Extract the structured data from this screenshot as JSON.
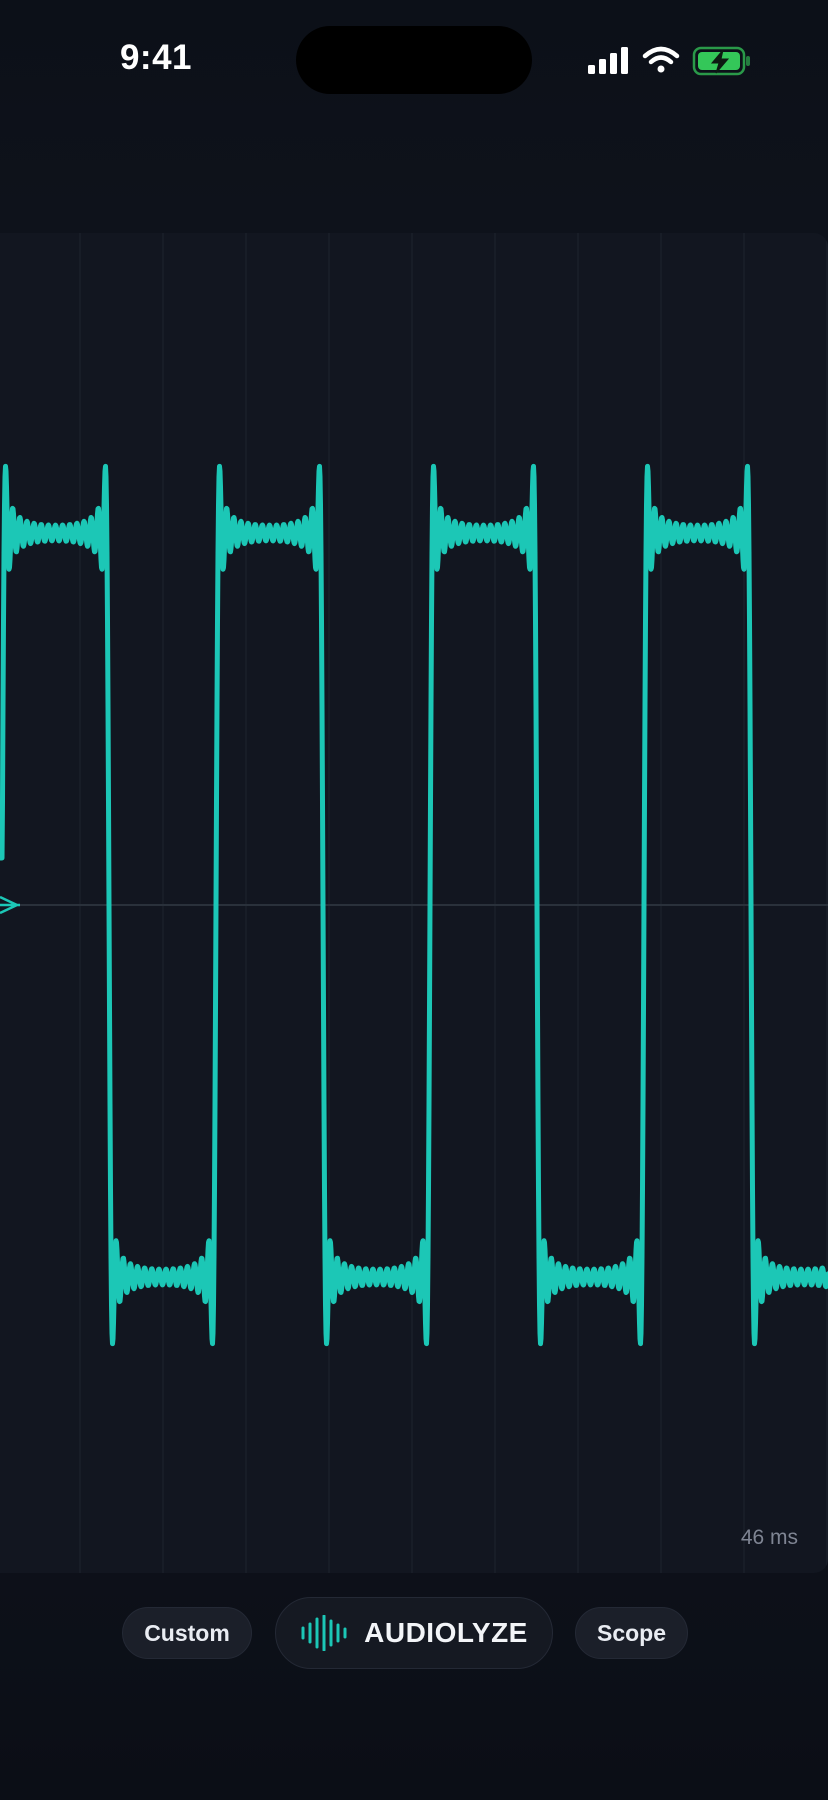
{
  "status_bar": {
    "time": "9:41",
    "icons": [
      "cellular-signal-icon",
      "wifi-icon",
      "battery-charging-icon"
    ]
  },
  "scope": {
    "time_window_label": "46 ms",
    "trace_color": "#1cc7b6",
    "trigger_marker": "trigger-arrow-icon"
  },
  "controls": {
    "custom_label": "Custom",
    "audiolyze_label": "AUDIOLYZE",
    "scope_label": "Scope"
  },
  "colors": {
    "accent": "#1cc7b6",
    "battery": "#34c759",
    "panel": "#121620"
  }
}
